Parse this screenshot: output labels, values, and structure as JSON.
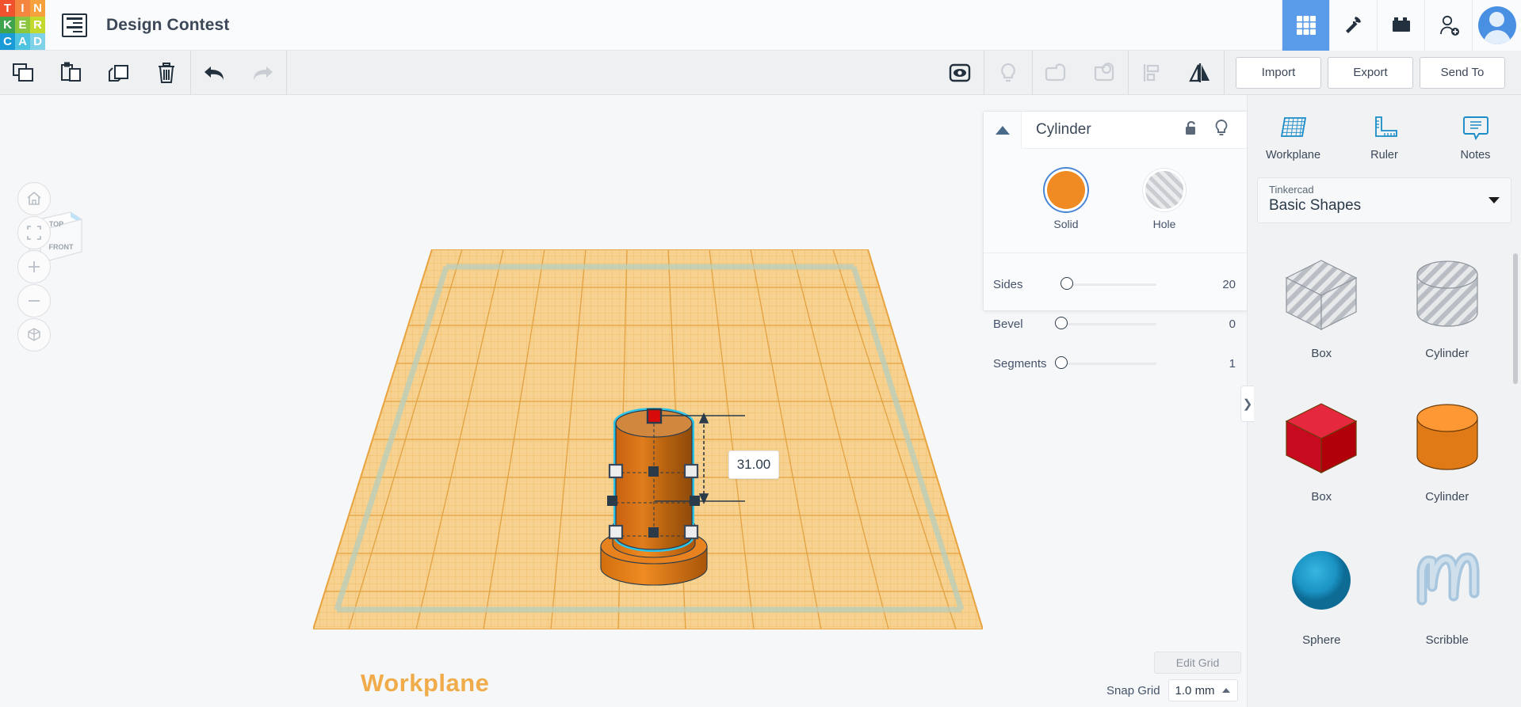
{
  "app": {
    "brand_letters": [
      "T",
      "I",
      "N",
      "K",
      "E",
      "R",
      "C",
      "A",
      "D"
    ],
    "brand_colors": [
      "#f0522e",
      "#f5863f",
      "#f7a13c",
      "#3fa34d",
      "#8cc63f",
      "#c3d92e",
      "#1a9ad7",
      "#4ec3e0",
      "#7fd1e8"
    ],
    "document_title": "Design Contest"
  },
  "topbar": {
    "icons": [
      {
        "name": "grid-apps-icon",
        "active": true
      },
      {
        "name": "pickaxe-minecraft-icon",
        "active": false
      },
      {
        "name": "lego-brick-icon",
        "active": false
      },
      {
        "name": "invite-person-icon",
        "active": false
      }
    ],
    "avatar_name": "user-avatar"
  },
  "toolbar": {
    "left_icons": [
      "copy-icon",
      "paste-icon",
      "duplicate-icon",
      "delete-icon",
      "undo-icon",
      "redo-icon"
    ],
    "mid_icons": [
      "group-icon",
      "light-bulb-icon",
      "shape-union-icon",
      "shape-subtract-icon",
      "align-icon",
      "mirror-icon"
    ],
    "import_label": "Import",
    "export_label": "Export",
    "send_to_label": "Send To"
  },
  "viewport": {
    "viewcube": {
      "top_label": "TOP",
      "front_label": "FRONT"
    },
    "nav_buttons": [
      "home-view-icon",
      "fit-view-icon",
      "zoom-in-icon",
      "zoom-out-icon",
      "orthographic-view-icon"
    ],
    "workplane_label": "Workplane",
    "dimension_value": "31.00",
    "shape_color": "#e8821e"
  },
  "inspector": {
    "title": "Cylinder",
    "collapse_icon": "chevron-up-icon",
    "lock_icon": "unlock-icon",
    "visibility_icon": "light-bulb-icon",
    "solid_label": "Solid",
    "hole_label": "Hole",
    "solid_color": "#ef8b22",
    "selected_swatch": "Solid",
    "sliders": [
      {
        "name": "Sides",
        "value": "20",
        "fill_pct": 6,
        "knob_pct": 6
      },
      {
        "name": "Bevel",
        "value": "0",
        "fill_pct": 0,
        "knob_pct": 0
      },
      {
        "name": "Segments",
        "value": "1",
        "fill_pct": 0,
        "knob_pct": 0
      }
    ]
  },
  "panel_toggle": {
    "glyph": "❯"
  },
  "sidebar": {
    "tools": [
      {
        "label": "Workplane",
        "icon": "workplane-icon"
      },
      {
        "label": "Ruler",
        "icon": "ruler-icon"
      },
      {
        "label": "Notes",
        "icon": "notes-icon"
      }
    ],
    "category": {
      "owner": "Tinkercad",
      "name": "Basic Shapes"
    },
    "shapes": [
      {
        "label": "Box",
        "kind": "box",
        "color": "hole"
      },
      {
        "label": "Cylinder",
        "kind": "cylinder",
        "color": "hole"
      },
      {
        "label": "Box",
        "kind": "box",
        "color": "#cf1228"
      },
      {
        "label": "Cylinder",
        "kind": "cylinder",
        "color": "#e8821e"
      },
      {
        "label": "Sphere",
        "kind": "sphere",
        "color": "#1b93c4"
      },
      {
        "label": "Scribble",
        "kind": "scribble",
        "color": "#a8c6dd"
      }
    ]
  },
  "bottom": {
    "edit_grid_label": "Edit Grid",
    "snap_grid_label": "Snap Grid",
    "snap_grid_value": "1.0 mm"
  }
}
